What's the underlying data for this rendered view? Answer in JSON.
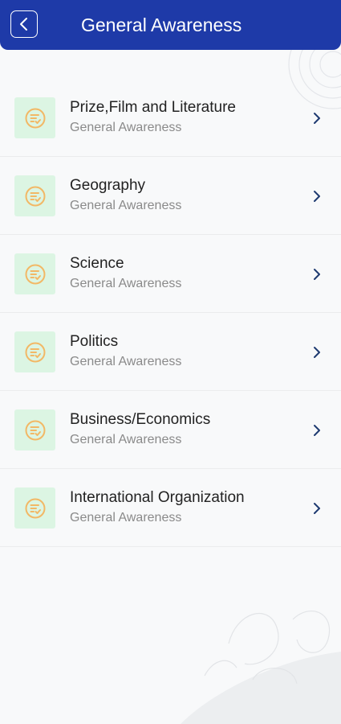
{
  "header": {
    "title": "General Awareness",
    "back_icon": "chevron-left-icon",
    "background_color": "#1e3aa8"
  },
  "categories": [
    {
      "title": "Prize,Film and Literature",
      "subtitle": "General Awareness",
      "icon": "task-check-icon"
    },
    {
      "title": "Geography",
      "subtitle": "General Awareness",
      "icon": "task-check-icon"
    },
    {
      "title": "Science",
      "subtitle": "General Awareness",
      "icon": "task-check-icon"
    },
    {
      "title": "Politics",
      "subtitle": "General Awareness",
      "icon": "task-check-icon"
    },
    {
      "title": "Business/Economics",
      "subtitle": "General Awareness",
      "icon": "task-check-icon"
    },
    {
      "title": "International Organization",
      "subtitle": "General Awareness",
      "icon": "task-check-icon"
    }
  ],
  "colors": {
    "icon_background": "#dcf5e3",
    "icon_accent": "#f2b866",
    "chevron": "#1e3a70"
  }
}
